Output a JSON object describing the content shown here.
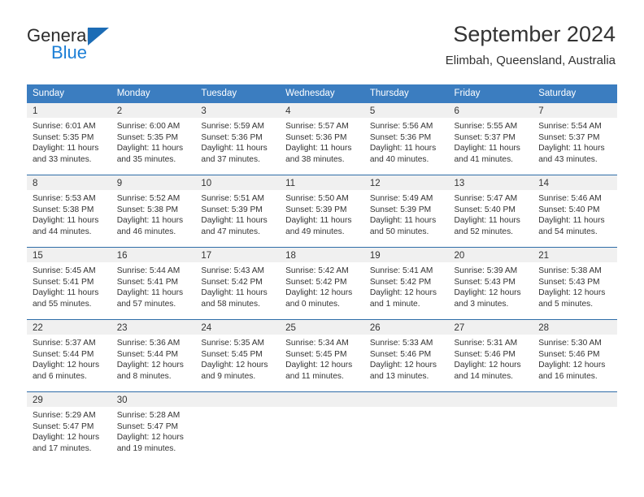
{
  "brand": {
    "name_part1": "General",
    "name_part2": "Blue",
    "triangle_color": "#1c6cb5",
    "blue_color": "#1c7fd6"
  },
  "header": {
    "title": "September 2024",
    "subtitle": "Elimbah, Queensland, Australia"
  },
  "theme": {
    "header_row_bg": "#3b7dc0",
    "header_row_text": "#ffffff",
    "week_divider": "#2f6da8",
    "daynum_band_bg": "#f0f0f0",
    "cell_bg": "#ffffff",
    "text": "#333333"
  },
  "calendar": {
    "weekday_headers": [
      "Sunday",
      "Monday",
      "Tuesday",
      "Wednesday",
      "Thursday",
      "Friday",
      "Saturday"
    ],
    "weeks": [
      [
        {
          "day": "1",
          "sunrise": "Sunrise: 6:01 AM",
          "sunset": "Sunset: 5:35 PM",
          "daylight1": "Daylight: 11 hours",
          "daylight2": "and 33 minutes."
        },
        {
          "day": "2",
          "sunrise": "Sunrise: 6:00 AM",
          "sunset": "Sunset: 5:35 PM",
          "daylight1": "Daylight: 11 hours",
          "daylight2": "and 35 minutes."
        },
        {
          "day": "3",
          "sunrise": "Sunrise: 5:59 AM",
          "sunset": "Sunset: 5:36 PM",
          "daylight1": "Daylight: 11 hours",
          "daylight2": "and 37 minutes."
        },
        {
          "day": "4",
          "sunrise": "Sunrise: 5:57 AM",
          "sunset": "Sunset: 5:36 PM",
          "daylight1": "Daylight: 11 hours",
          "daylight2": "and 38 minutes."
        },
        {
          "day": "5",
          "sunrise": "Sunrise: 5:56 AM",
          "sunset": "Sunset: 5:36 PM",
          "daylight1": "Daylight: 11 hours",
          "daylight2": "and 40 minutes."
        },
        {
          "day": "6",
          "sunrise": "Sunrise: 5:55 AM",
          "sunset": "Sunset: 5:37 PM",
          "daylight1": "Daylight: 11 hours",
          "daylight2": "and 41 minutes."
        },
        {
          "day": "7",
          "sunrise": "Sunrise: 5:54 AM",
          "sunset": "Sunset: 5:37 PM",
          "daylight1": "Daylight: 11 hours",
          "daylight2": "and 43 minutes."
        }
      ],
      [
        {
          "day": "8",
          "sunrise": "Sunrise: 5:53 AM",
          "sunset": "Sunset: 5:38 PM",
          "daylight1": "Daylight: 11 hours",
          "daylight2": "and 44 minutes."
        },
        {
          "day": "9",
          "sunrise": "Sunrise: 5:52 AM",
          "sunset": "Sunset: 5:38 PM",
          "daylight1": "Daylight: 11 hours",
          "daylight2": "and 46 minutes."
        },
        {
          "day": "10",
          "sunrise": "Sunrise: 5:51 AM",
          "sunset": "Sunset: 5:39 PM",
          "daylight1": "Daylight: 11 hours",
          "daylight2": "and 47 minutes."
        },
        {
          "day": "11",
          "sunrise": "Sunrise: 5:50 AM",
          "sunset": "Sunset: 5:39 PM",
          "daylight1": "Daylight: 11 hours",
          "daylight2": "and 49 minutes."
        },
        {
          "day": "12",
          "sunrise": "Sunrise: 5:49 AM",
          "sunset": "Sunset: 5:39 PM",
          "daylight1": "Daylight: 11 hours",
          "daylight2": "and 50 minutes."
        },
        {
          "day": "13",
          "sunrise": "Sunrise: 5:47 AM",
          "sunset": "Sunset: 5:40 PM",
          "daylight1": "Daylight: 11 hours",
          "daylight2": "and 52 minutes."
        },
        {
          "day": "14",
          "sunrise": "Sunrise: 5:46 AM",
          "sunset": "Sunset: 5:40 PM",
          "daylight1": "Daylight: 11 hours",
          "daylight2": "and 54 minutes."
        }
      ],
      [
        {
          "day": "15",
          "sunrise": "Sunrise: 5:45 AM",
          "sunset": "Sunset: 5:41 PM",
          "daylight1": "Daylight: 11 hours",
          "daylight2": "and 55 minutes."
        },
        {
          "day": "16",
          "sunrise": "Sunrise: 5:44 AM",
          "sunset": "Sunset: 5:41 PM",
          "daylight1": "Daylight: 11 hours",
          "daylight2": "and 57 minutes."
        },
        {
          "day": "17",
          "sunrise": "Sunrise: 5:43 AM",
          "sunset": "Sunset: 5:42 PM",
          "daylight1": "Daylight: 11 hours",
          "daylight2": "and 58 minutes."
        },
        {
          "day": "18",
          "sunrise": "Sunrise: 5:42 AM",
          "sunset": "Sunset: 5:42 PM",
          "daylight1": "Daylight: 12 hours",
          "daylight2": "and 0 minutes."
        },
        {
          "day": "19",
          "sunrise": "Sunrise: 5:41 AM",
          "sunset": "Sunset: 5:42 PM",
          "daylight1": "Daylight: 12 hours",
          "daylight2": "and 1 minute."
        },
        {
          "day": "20",
          "sunrise": "Sunrise: 5:39 AM",
          "sunset": "Sunset: 5:43 PM",
          "daylight1": "Daylight: 12 hours",
          "daylight2": "and 3 minutes."
        },
        {
          "day": "21",
          "sunrise": "Sunrise: 5:38 AM",
          "sunset": "Sunset: 5:43 PM",
          "daylight1": "Daylight: 12 hours",
          "daylight2": "and 5 minutes."
        }
      ],
      [
        {
          "day": "22",
          "sunrise": "Sunrise: 5:37 AM",
          "sunset": "Sunset: 5:44 PM",
          "daylight1": "Daylight: 12 hours",
          "daylight2": "and 6 minutes."
        },
        {
          "day": "23",
          "sunrise": "Sunrise: 5:36 AM",
          "sunset": "Sunset: 5:44 PM",
          "daylight1": "Daylight: 12 hours",
          "daylight2": "and 8 minutes."
        },
        {
          "day": "24",
          "sunrise": "Sunrise: 5:35 AM",
          "sunset": "Sunset: 5:45 PM",
          "daylight1": "Daylight: 12 hours",
          "daylight2": "and 9 minutes."
        },
        {
          "day": "25",
          "sunrise": "Sunrise: 5:34 AM",
          "sunset": "Sunset: 5:45 PM",
          "daylight1": "Daylight: 12 hours",
          "daylight2": "and 11 minutes."
        },
        {
          "day": "26",
          "sunrise": "Sunrise: 5:33 AM",
          "sunset": "Sunset: 5:46 PM",
          "daylight1": "Daylight: 12 hours",
          "daylight2": "and 13 minutes."
        },
        {
          "day": "27",
          "sunrise": "Sunrise: 5:31 AM",
          "sunset": "Sunset: 5:46 PM",
          "daylight1": "Daylight: 12 hours",
          "daylight2": "and 14 minutes."
        },
        {
          "day": "28",
          "sunrise": "Sunrise: 5:30 AM",
          "sunset": "Sunset: 5:46 PM",
          "daylight1": "Daylight: 12 hours",
          "daylight2": "and 16 minutes."
        }
      ],
      [
        {
          "day": "29",
          "sunrise": "Sunrise: 5:29 AM",
          "sunset": "Sunset: 5:47 PM",
          "daylight1": "Daylight: 12 hours",
          "daylight2": "and 17 minutes."
        },
        {
          "day": "30",
          "sunrise": "Sunrise: 5:28 AM",
          "sunset": "Sunset: 5:47 PM",
          "daylight1": "Daylight: 12 hours",
          "daylight2": "and 19 minutes."
        },
        {
          "day": "",
          "sunrise": "",
          "sunset": "",
          "daylight1": "",
          "daylight2": ""
        },
        {
          "day": "",
          "sunrise": "",
          "sunset": "",
          "daylight1": "",
          "daylight2": ""
        },
        {
          "day": "",
          "sunrise": "",
          "sunset": "",
          "daylight1": "",
          "daylight2": ""
        },
        {
          "day": "",
          "sunrise": "",
          "sunset": "",
          "daylight1": "",
          "daylight2": ""
        },
        {
          "day": "",
          "sunrise": "",
          "sunset": "",
          "daylight1": "",
          "daylight2": ""
        }
      ]
    ]
  }
}
